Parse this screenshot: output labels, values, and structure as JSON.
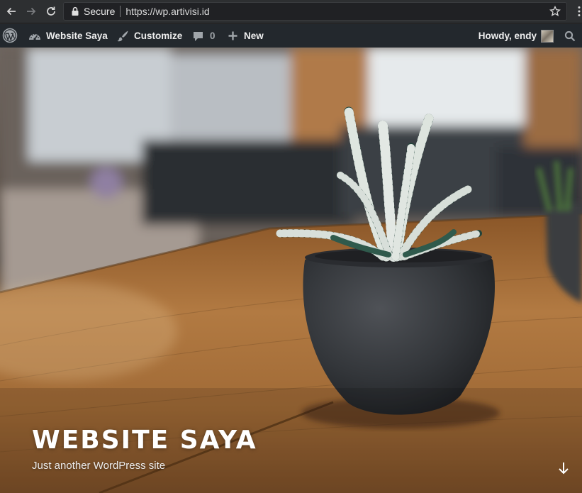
{
  "browser": {
    "secure_label": "Secure",
    "url": "https://wp.artivisi.id"
  },
  "admin_bar": {
    "site_name": "Website Saya",
    "customize_label": "Customize",
    "comments_count": "0",
    "new_label": "New",
    "howdy_label": "Howdy, endy"
  },
  "hero": {
    "site_title": "WEBSITE SAYA",
    "tagline": "Just another WordPress site"
  },
  "colors": {
    "admin_bar_bg": "#23282d",
    "chrome_bg": "#2d2f31"
  }
}
